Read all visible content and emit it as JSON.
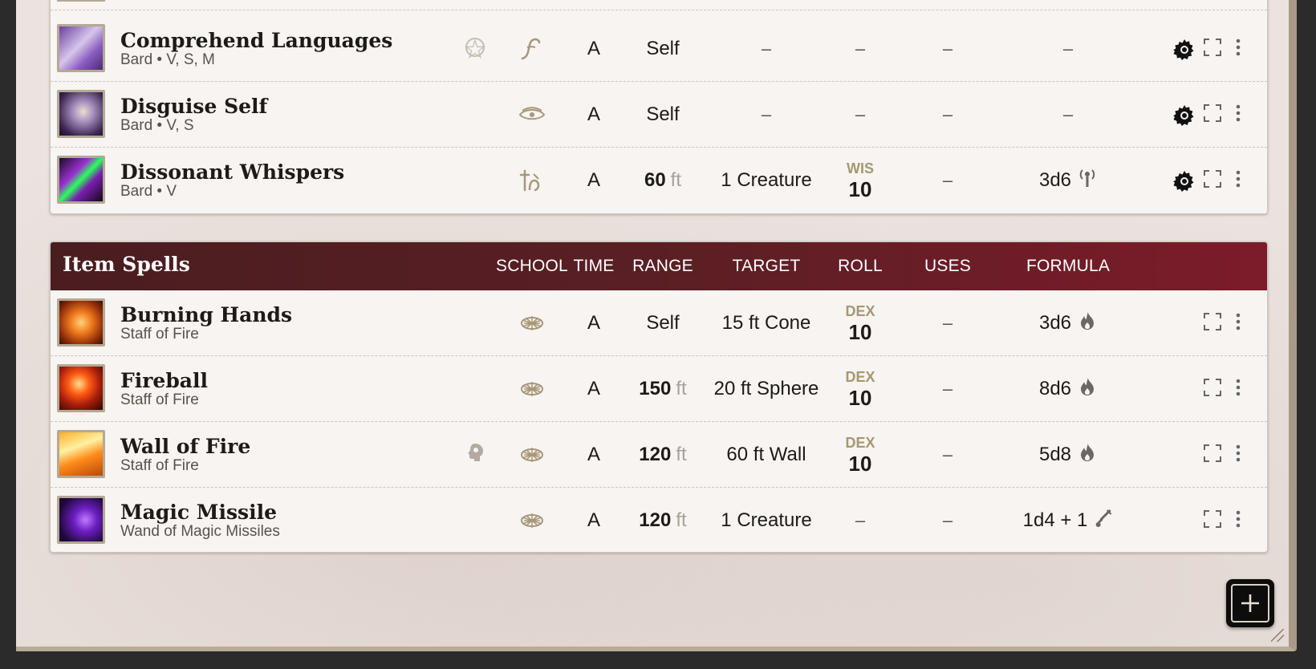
{
  "colors": {
    "header_start": "#4a1d20",
    "header_end": "#7d1b2a",
    "roll_label": "#a59872",
    "icon_tint": "#a8977a"
  },
  "class_spells": [
    {
      "name": "Comprehend Languages",
      "sub": "Bard • V, S, M",
      "school_icon": "divination-icon",
      "time": "A",
      "range": "Self",
      "range_unit": "",
      "target": "–",
      "roll_abbr": "",
      "roll_val": "–",
      "uses": "–",
      "formula": "–",
      "formula_icon": "",
      "marker": "ritual-icon"
    },
    {
      "name": "Disguise Self",
      "sub": "Bard • V, S",
      "school_icon": "illusion-icon",
      "time": "A",
      "range": "Self",
      "range_unit": "",
      "target": "–",
      "roll_abbr": "",
      "roll_val": "–",
      "uses": "–",
      "formula": "–",
      "formula_icon": "",
      "marker": ""
    },
    {
      "name": "Dissonant Whispers",
      "sub": "Bard • V",
      "school_icon": "enchantment-icon",
      "time": "A",
      "range": "60",
      "range_unit": "ft",
      "target": "1 Creature",
      "roll_abbr": "WIS",
      "roll_val": "10",
      "uses": "–",
      "formula": "3d6",
      "formula_icon": "psychic-damage-icon",
      "marker": ""
    }
  ],
  "item_section": {
    "title": "Item Spells",
    "columns": {
      "school": "SCHOOL",
      "time": "TIME",
      "range": "RANGE",
      "target": "TARGET",
      "roll": "ROLL",
      "uses": "USES",
      "formula": "FORMULA"
    }
  },
  "item_spells": [
    {
      "name": "Burning Hands",
      "sub": "Staff of Fire",
      "school_icon": "evocation-icon",
      "time": "A",
      "range": "Self",
      "range_unit": "",
      "target": "15 ft Cone",
      "roll_abbr": "DEX",
      "roll_val": "10",
      "uses": "–",
      "formula": "3d6",
      "formula_icon": "fire-damage-icon",
      "marker": ""
    },
    {
      "name": "Fireball",
      "sub": "Staff of Fire",
      "school_icon": "evocation-icon",
      "time": "A",
      "range": "150",
      "range_unit": "ft",
      "target": "20 ft Sphere",
      "roll_abbr": "DEX",
      "roll_val": "10",
      "uses": "–",
      "formula": "8d6",
      "formula_icon": "fire-damage-icon",
      "marker": ""
    },
    {
      "name": "Wall of Fire",
      "sub": "Staff of Fire",
      "school_icon": "evocation-icon",
      "time": "A",
      "range": "120",
      "range_unit": "ft",
      "target": "60 ft Wall",
      "roll_abbr": "DEX",
      "roll_val": "10",
      "uses": "–",
      "formula": "5d8",
      "formula_icon": "fire-damage-icon",
      "marker": "concentration-icon"
    },
    {
      "name": "Magic Missile",
      "sub": "Wand of Magic Missiles",
      "school_icon": "evocation-icon",
      "time": "A",
      "range": "120",
      "range_unit": "ft",
      "target": "1 Creature",
      "roll_abbr": "",
      "roll_val": "–",
      "uses": "–",
      "formula": "1d4 + 1",
      "formula_icon": "force-damage-icon",
      "marker": ""
    }
  ],
  "add_button": {
    "icon": "plus-icon"
  }
}
